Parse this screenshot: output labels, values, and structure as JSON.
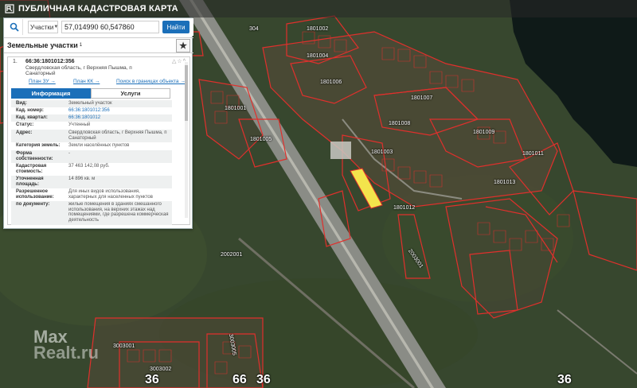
{
  "header": {
    "title": "ПУБЛИЧНАЯ КАДАСТРОВАЯ КАРТА"
  },
  "search": {
    "type_value": "Участки",
    "query_value": "57,014990 60,547860",
    "find_label": "Найти"
  },
  "results": {
    "title": "Земельные участки",
    "count": "1"
  },
  "card": {
    "index": "1.",
    "cadastral_number": "66:36:1801012:356",
    "address": "Свердловская область, г Верхняя Пышма, п Санаторный",
    "link_plan_zu": "План ЗУ →",
    "link_plan_kk": "План КК →",
    "link_search": "Поиск в границах объекта →",
    "tab_info": "Информация",
    "tab_services": "Услуги",
    "fields": [
      {
        "k": "Вид:",
        "v": "Земельный участок"
      },
      {
        "k": "Кад. номер:",
        "v": "66:36:1801012:356"
      },
      {
        "k": "Кад. квартал:",
        "v": "66:36:1801012"
      },
      {
        "k": "Статус:",
        "v": "Учтенный"
      },
      {
        "k": "Адрес:",
        "v": "Свердловская область, г Верхняя Пышма, п Санаторный"
      },
      {
        "k": "Категория земель:",
        "v": "Земли населённых пунктов"
      },
      {
        "k": "Форма собственности:",
        "v": "-"
      },
      {
        "k": "Кадастровая стоимость:",
        "v": "37 463 142,08 руб."
      },
      {
        "k": "Уточненная площадь:",
        "v": "14 896 кв. м"
      },
      {
        "k": "Разрешенное использование:",
        "v": "Для иных видов использования, характерных для населенных пунктов"
      },
      {
        "k": "по документу:",
        "v": "жилые помещения в зданиях смешанного использования, на верхних этажах над помещениями, где разрешена коммерческая деятельность"
      }
    ]
  },
  "map_labels": {
    "l304": "304",
    "l1801002": "1801002",
    "l1801004": "1801004",
    "l1801006": "1801006",
    "l1801001": "1801001",
    "l1801005": "1801005",
    "l1801003": "1801003",
    "l1801007": "1801007",
    "l1801008": "1801008",
    "l1801009": "1801009",
    "l1801011": "1801011",
    "l1801012": "1801012",
    "l1801013": "1801013",
    "l2002001": "2002001",
    "l2003001": "2003001",
    "l3003001": "3003001",
    "l3003002": "3003002",
    "l3003005": "3003005",
    "l36": "36",
    "l66": "66",
    "l36b": "36",
    "l36c": "36"
  },
  "watermark": {
    "line1": "Max",
    "line2": "Realt.ru"
  },
  "colors": {
    "accent": "#1b6fb9",
    "parcel_border": "#e0302c",
    "highlight": "#f3e44c"
  }
}
